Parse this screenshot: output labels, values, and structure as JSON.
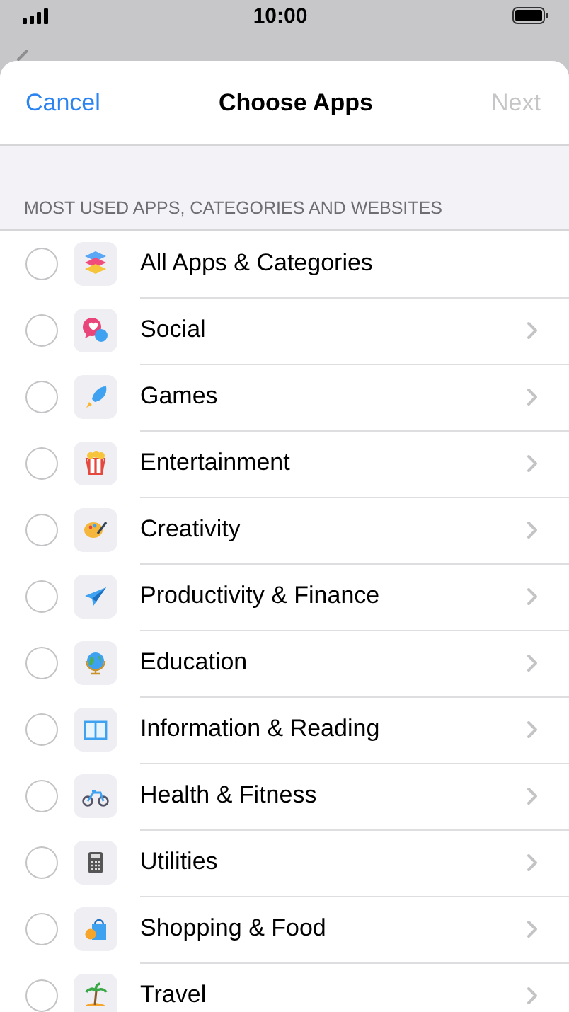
{
  "status_bar": {
    "time": "10:00"
  },
  "sheet": {
    "cancel": "Cancel",
    "title": "Choose Apps",
    "next": "Next",
    "next_disabled": true
  },
  "section_header": "MOST USED APPS, CATEGORIES AND WEBSITES",
  "categories": [
    {
      "label": "All Apps & Categories",
      "selected": false,
      "chevron": false
    },
    {
      "label": "Social",
      "selected": false,
      "chevron": true
    },
    {
      "label": "Games",
      "selected": false,
      "chevron": true
    },
    {
      "label": "Entertainment",
      "selected": false,
      "chevron": true
    },
    {
      "label": "Creativity",
      "selected": false,
      "chevron": true
    },
    {
      "label": "Productivity & Finance",
      "selected": false,
      "chevron": true
    },
    {
      "label": "Education",
      "selected": false,
      "chevron": true
    },
    {
      "label": "Information & Reading",
      "selected": false,
      "chevron": true
    },
    {
      "label": "Health & Fitness",
      "selected": false,
      "chevron": true
    },
    {
      "label": "Utilities",
      "selected": false,
      "chevron": true
    },
    {
      "label": "Shopping & Food",
      "selected": false,
      "chevron": true
    },
    {
      "label": "Travel",
      "selected": false,
      "chevron": true
    }
  ]
}
